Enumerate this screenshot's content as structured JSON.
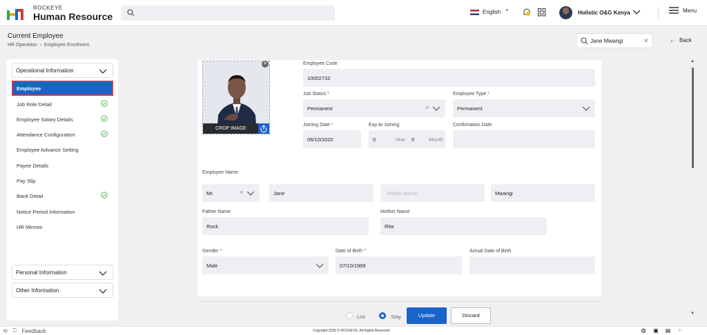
{
  "brand": {
    "small": "ROCKEYE",
    "big": "Human Resource"
  },
  "header": {
    "search_placeholder": "",
    "language": "English",
    "user_name": "Holistic O&G Kenya",
    "menu_label": "Menu"
  },
  "page": {
    "title": "Current Employee",
    "breadcrumb_root": "HR Operation",
    "breadcrumb_current": "Employee Enrolment",
    "employee_search_value": "Jane Mwangi",
    "back_label": "Back"
  },
  "sidebar": {
    "sections": [
      {
        "label": "Operational Information"
      },
      {
        "label": "Personal Information"
      },
      {
        "label": "Other Information"
      }
    ],
    "items": [
      {
        "label": "Employee",
        "checked": false
      },
      {
        "label": "Job Role Detail",
        "checked": true
      },
      {
        "label": "Employee Salary Details",
        "checked": true
      },
      {
        "label": "Attendance Configuration",
        "checked": true
      },
      {
        "label": "Employee Advance Setting",
        "checked": false
      },
      {
        "label": "Payee Details",
        "checked": false
      },
      {
        "label": "Pay Slip",
        "checked": false
      },
      {
        "label": "Bank Detail",
        "checked": true
      },
      {
        "label": "Notice Period Information",
        "checked": false
      },
      {
        "label": "HR Memos",
        "checked": false
      }
    ]
  },
  "photo": {
    "crop_label": "CROP IMAGE"
  },
  "form": {
    "employee_code": {
      "label": "Employee Code",
      "value": "10002732"
    },
    "job_status": {
      "label": "Job Status",
      "required": "*",
      "value": "Permanent"
    },
    "employee_type": {
      "label": "Employee Type",
      "required": "*",
      "value": "Permanent"
    },
    "joining_date": {
      "label": "Joining Date",
      "required": "*",
      "value": "06/10/2020"
    },
    "exp_at_joining": {
      "label": "Exp At Joining",
      "years": "0",
      "year_unit": "Year",
      "months": "0",
      "month_unit": "Month"
    },
    "confirmation_date": {
      "label": "Confirmation Date",
      "value": ""
    },
    "employee_name": {
      "label": "Employee Name",
      "title": "Mr.",
      "first": "Jane",
      "middle_placeholder": "Middle Name",
      "last": "Mwangi"
    },
    "father_name": {
      "label": "Father Name",
      "value": "Rock"
    },
    "mother_name": {
      "label": "Mother Name",
      "value": "Rita"
    },
    "gender": {
      "label": "Gender",
      "required": "*",
      "value": "Male"
    },
    "dob": {
      "label": "Date of Birth",
      "required": "*",
      "value": "07/10/1969"
    },
    "actual_dob": {
      "label": "Actual Date of Birth",
      "value": ""
    }
  },
  "actions": {
    "list_label": "List",
    "stay_label": "Stay",
    "selected": "Stay",
    "update_label": "Update",
    "discard_label": "Discard"
  },
  "status": {
    "feedback": "Feedback",
    "copyright": "Copyright 2025 © ROCKEYE. All Rights Reserved"
  },
  "colors": {
    "accent": "#1a63c9",
    "active_outline": "#e0353a",
    "check": "#5cb85c"
  }
}
